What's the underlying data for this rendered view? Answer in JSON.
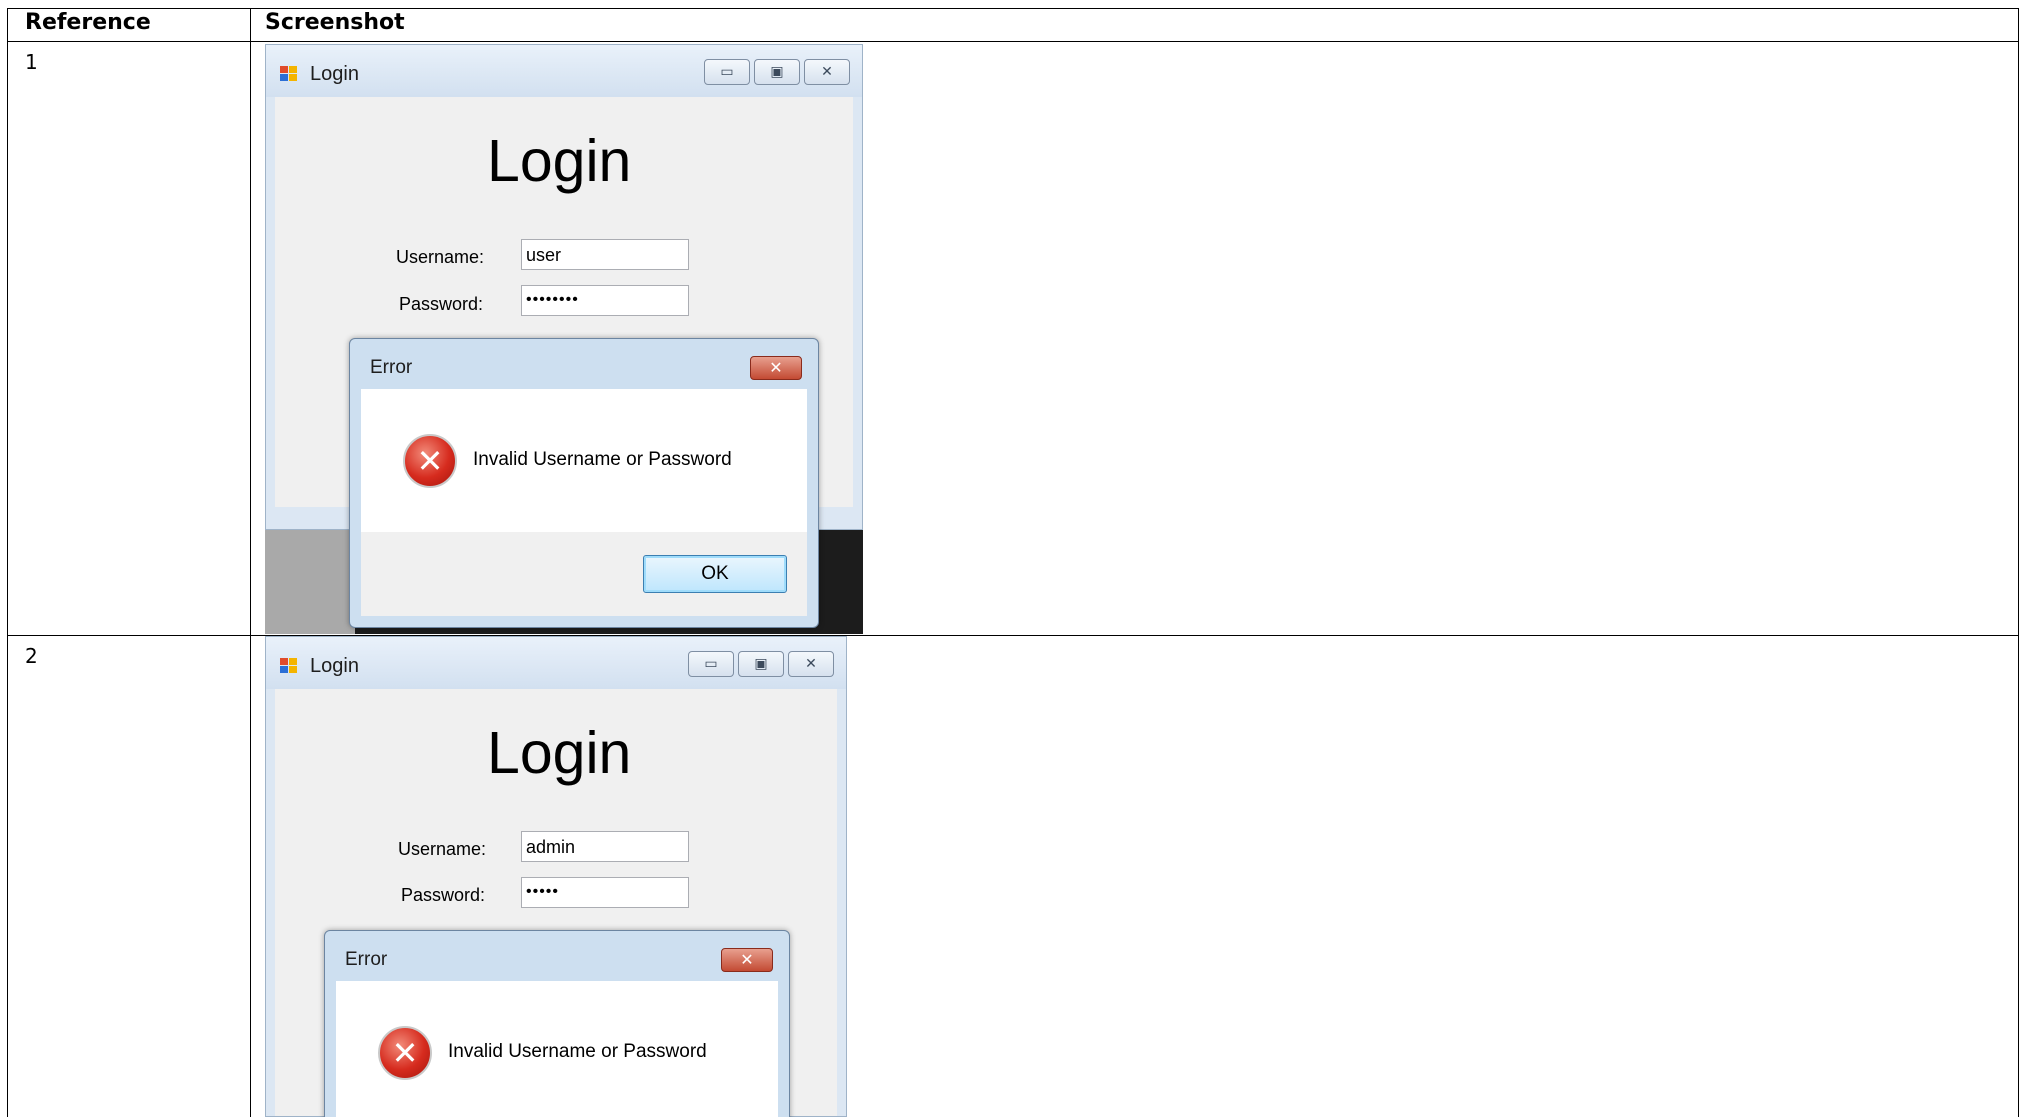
{
  "table": {
    "headers": {
      "reference": "Reference",
      "screenshot": "Screenshot"
    },
    "rows": [
      {
        "reference": "1",
        "window": {
          "title": "Login",
          "heading": "Login",
          "username_label": "Username:",
          "username_value": "user",
          "password_label": "Password:",
          "password_value": "••••••••"
        },
        "dialog": {
          "title": "Error",
          "close_glyph": "✕",
          "message": "Invalid Username or Password",
          "ok_label": "OK"
        }
      },
      {
        "reference": "2",
        "window": {
          "title": "Login",
          "heading": "Login",
          "username_label": "Username:",
          "username_value": "admin",
          "password_label": "Password:",
          "password_value": "•••••"
        },
        "dialog": {
          "title": "Error",
          "close_glyph": "✕",
          "message": "Invalid Username or Password"
        }
      }
    ]
  },
  "icons": {
    "app_icon": "windows-form-icon",
    "minimize": "minimize-icon",
    "maximize": "maximize-icon",
    "close": "close-icon",
    "error": "error-icon"
  }
}
